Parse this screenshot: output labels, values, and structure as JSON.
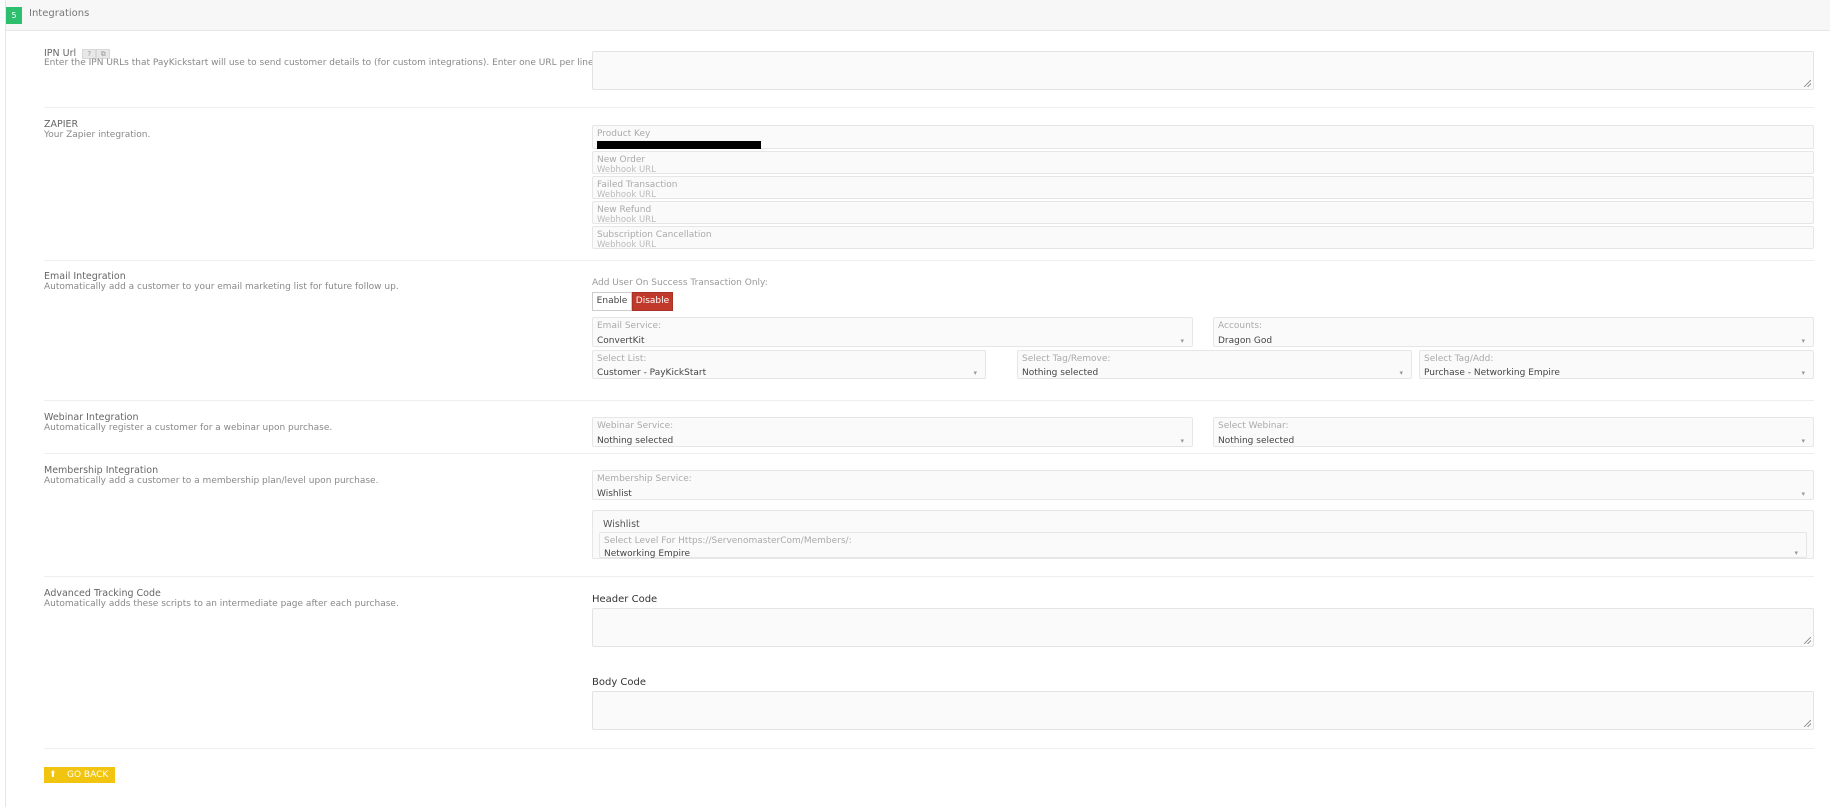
{
  "header": {
    "step": "5",
    "title": "Integrations"
  },
  "ipn": {
    "title": "IPN Url",
    "help_q": "?",
    "help_copy": "⧉",
    "desc": "Enter the IPN URLs that PayKickstart will use to send customer details to (for custom integrations). Enter one URL per line."
  },
  "zapier": {
    "title": "ZAPIER",
    "desc": "Your Zapier integration.",
    "product_key_label": "Product Key",
    "rows": [
      {
        "label": "New Order",
        "sub": "Webhook URL"
      },
      {
        "label": "Failed Transaction",
        "sub": "Webhook URL"
      },
      {
        "label": "New Refund",
        "sub": "Webhook URL"
      },
      {
        "label": "Subscription Cancellation",
        "sub": "Webhook URL"
      }
    ]
  },
  "email": {
    "title": "Email Integration",
    "desc": "Automatically add a customer to your email marketing list for future follow up.",
    "success_label": "Add User On Success Transaction Only:",
    "enable_label": "Enable",
    "disable_label": "Disable",
    "service_label": "Email Service:",
    "service_value": "ConvertKit",
    "accounts_label": "Accounts:",
    "accounts_value": "Dragon God",
    "list_label": "Select List:",
    "list_value": "Customer - PayKickStart",
    "tag_remove_label": "Select Tag/Remove:",
    "tag_remove_value": "Nothing selected",
    "tag_add_label": "Select Tag/Add:",
    "tag_add_value": "Purchase - Networking Empire"
  },
  "webinar": {
    "title": "Webinar Integration",
    "desc": "Automatically register a customer for a webinar upon purchase.",
    "service_label": "Webinar Service:",
    "service_value": "Nothing selected",
    "select_label": "Select Webinar:",
    "select_value": "Nothing selected"
  },
  "membership": {
    "title": "Membership Integration",
    "desc": "Automatically add a customer to a membership plan/level upon purchase.",
    "service_label": "Membership Service:",
    "service_value": "Wishlist",
    "box_title": "Wishlist",
    "level_label": "Select Level For Https://ServenomasterCom/Members/:",
    "level_value": "Networking Empire"
  },
  "tracking": {
    "title": "Advanced Tracking Code",
    "desc": "Automatically adds these scripts to an intermediate page after each purchase.",
    "header_label": "Header Code",
    "body_label": "Body Code"
  },
  "footer": {
    "go_back": "GO BACK",
    "go_back_icon": "arrow-up-icon"
  }
}
